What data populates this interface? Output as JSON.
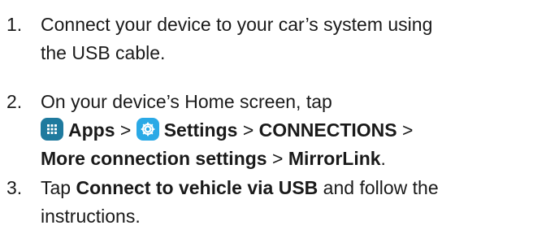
{
  "steps": [
    {
      "number": "1.",
      "line1": "Connect your device to your car’s system using",
      "line2": "the USB cable."
    },
    {
      "number": "2.",
      "intro": "On your device’s Home screen, tap",
      "apps_label": "Apps",
      "sep1": " > ",
      "settings_label": "Settings",
      "sep2": " > ",
      "connections_label": "CONNECTIONS",
      "sep3": " >",
      "more_label": "More connection settings",
      "sep4": " > ",
      "mirrorlink_label": "MirrorLink",
      "end": "."
    },
    {
      "number": "3.",
      "prefix": "Tap ",
      "connect_label": "Connect to vehicle via USB",
      "suffix": " and follow the",
      "line2": "instructions."
    }
  ],
  "icons": {
    "apps": "apps-grid-icon",
    "settings": "settings-gear-icon"
  },
  "colors": {
    "text": "#1a1a1a",
    "apps_icon_bg": "#1f7a9e",
    "settings_icon_bg": "#2aa9e6"
  }
}
